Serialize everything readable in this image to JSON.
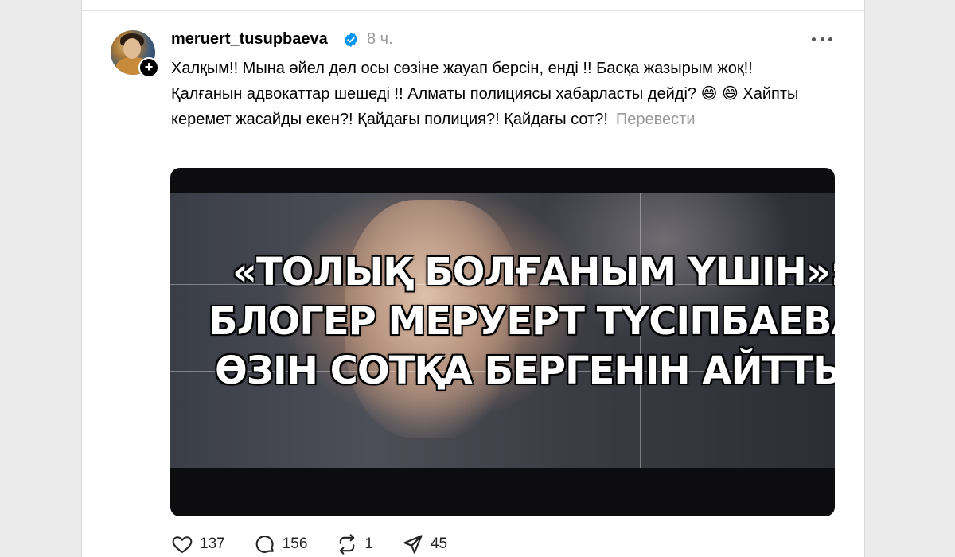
{
  "post": {
    "username": "meruert_tusupbaeva",
    "timestamp": "8 ч.",
    "text": "Халқым!! Мына әйел дәл осы сөзіне жауап берсін, енді !! Басқа жазырым жоқ!! Қалғанын адвокаттар шешеді !! Алматы полициясы хабарласты дейді? 😄 😄  Хайпты керемет жасайды екен?! Қайдағы полиция?! Қайдағы сот?!",
    "translate_label": "Перевести",
    "media_headline": {
      "line1": "«ТОЛЫҚ БОЛҒАНЫМ ҮШІН»:",
      "line2": "БЛОГЕР МЕРУЕРТ ТҮСІПБАЕВА",
      "line3": "ӨЗІН СОТҚА БЕРГЕНІН АЙТТЫ"
    }
  },
  "actions": {
    "likes": "137",
    "comments": "156",
    "reposts": "1",
    "shares": "45"
  },
  "icons": {
    "verified": "verified-badge-icon",
    "more": "more-options-icon",
    "like": "heart-icon",
    "comment": "comment-icon",
    "repost": "repost-icon",
    "share": "send-icon"
  },
  "colors": {
    "verified": "#0095f6",
    "muted": "#999999"
  }
}
